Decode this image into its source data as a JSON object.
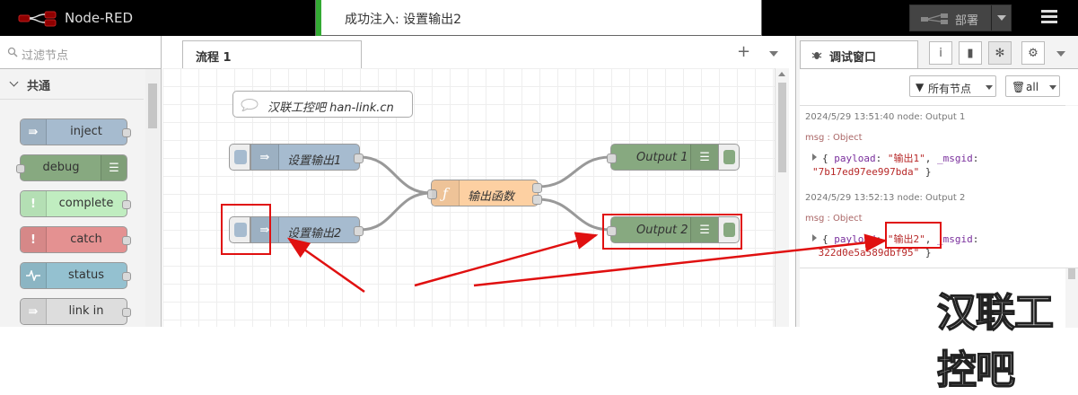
{
  "app": {
    "title": "Node-RED"
  },
  "notification": {
    "text": "成功注入: 设置输出2"
  },
  "header": {
    "deploy_label": "部署"
  },
  "palette": {
    "filter_placeholder": "过滤节点",
    "category": "共通",
    "nodes": [
      {
        "label": "inject",
        "color": "#a6bbcf"
      },
      {
        "label": "debug",
        "color": "#87a980"
      },
      {
        "label": "complete",
        "color": "#c0edc0"
      },
      {
        "label": "catch",
        "color": "#e49191"
      },
      {
        "label": "status",
        "color": "#94c1d0"
      },
      {
        "label": "link in",
        "color": "#dddddd"
      }
    ]
  },
  "workspace": {
    "tab_label": "流程 1",
    "comment": "汉联工控吧 han-link.cn",
    "nodes": {
      "inject1": "设置输出1",
      "inject2": "设置输出2",
      "function": "输出函数",
      "output1": "Output 1",
      "output2": "Output 2"
    }
  },
  "sidebar": {
    "tab_label": "调试窗口",
    "filter_nodes": "所有节点",
    "clear_filter": "all",
    "messages": [
      {
        "meta": "2024/5/29 13:51:40   node: Output 1",
        "topic": "msg : Object",
        "line1_key": "payload",
        "line1_val": "\"输出1\"",
        "line1_key2": "_msgid",
        "line2": "\"7b17ed97ee997bda\""
      },
      {
        "meta": "2024/5/29 13:52:13   node: Output 2",
        "topic": "msg : Object",
        "line1_key": "payload",
        "line1_val": "\"输出2\"",
        "line1_key2": "_msgid",
        "line2": "322d0e5a589dbf95\""
      }
    ]
  },
  "watermark": "汉联工控吧",
  "colors": {
    "annotation": "#e01010",
    "inject": "#a6bbcf",
    "debug": "#87a980",
    "function": "#fdd0a2",
    "success": "#33aa33"
  }
}
